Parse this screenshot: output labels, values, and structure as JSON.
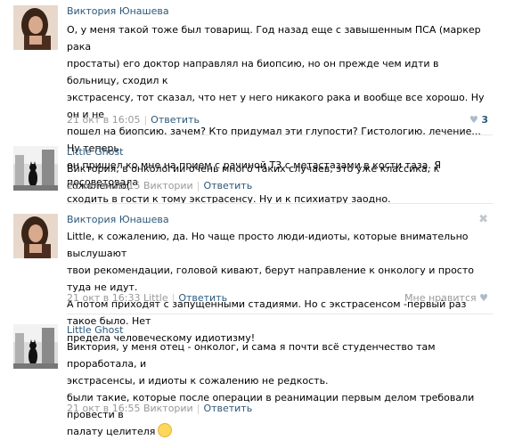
{
  "comments": [
    {
      "author": "Виктория Юнашева",
      "text": "О, у меня такой тоже был товарищ. Год назад еще с завышенным ПСА (маркер рака\nпростаты) его доктор направлял на биопсию, но он прежде чем идти в больницу, сходил к\nэкстрасенсу, тот сказал, что нет у него никакого рака и вообще все хорошо. Ну он и не\nпошел на биопсию, зачем? Кто придумал эти глупости? Гистологию, лечение... Ну теперь\nон пришел ко мне на прием с рачиной Т3 с метастазами в кости таза. Я посоветовала\nсходить в гости к тому экстрасенсу. Ну и к психиатру заодно.",
      "date": "21 окт в 16:05",
      "reply_to": "",
      "reply_label": "Ответить",
      "likes": "3"
    },
    {
      "author": "Little Ghost",
      "text": "Виктория, в онкологии очень много таких случаев, это уже классика, к сожалению(",
      "date": "21 окт в 16:15",
      "reply_to": "Виктории",
      "reply_label": "Ответить"
    },
    {
      "author": "Виктория Юнашева",
      "text": "Little, к сожалению, да. Но чаще просто люди-идиоты, которые внимательно выслушают\nтвои рекомендации, головой кивают, берут направление к онкологу и просто туда не идут.\nА потом приходят с запущенными стадиями. Но с экстрасенсом -первый раз такое было. Нет\nпредела человеческому идиотизму!",
      "date": "21 окт в 16:33",
      "reply_to": "Little",
      "reply_label": "Ответить",
      "like_label": "Мне нравится",
      "close_glyph": "✖"
    },
    {
      "author": "Little Ghost",
      "text": "Виктория, у меня отец - онколог, и сама я почти всё студенчество там проработала, и\nэкстрасенсы, и идиоты к сожалению не редкость.\nбыли такие, которые после операции в реанимации первым делом требовали провести в\nпалату целителя",
      "date": "21 окт в 16:55",
      "reply_to": "Виктории",
      "reply_label": "Ответить"
    }
  ],
  "colors": {
    "link": "#2b587a",
    "meta": "#999999",
    "divider": "#e7e8ec"
  }
}
